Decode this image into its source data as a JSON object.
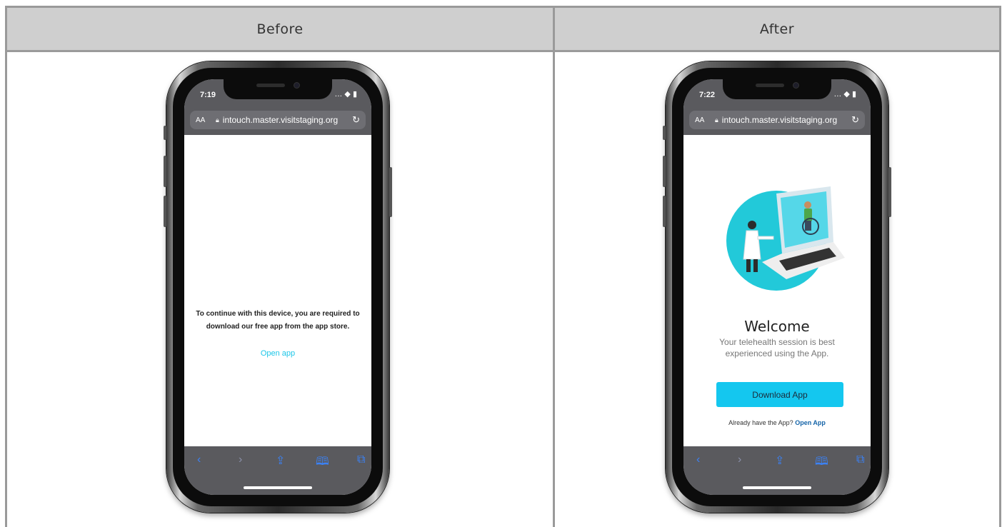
{
  "table": {
    "before_header": "Before",
    "after_header": "After"
  },
  "before_phone": {
    "time": "7:19",
    "status_icons": "… ◆ ▮",
    "text_size_label": "AA",
    "url": "intouch.master.visitstaging.org",
    "message": "To continue with this device, you are required to download our free app from the app store.",
    "open_app_link": "Open app"
  },
  "after_phone": {
    "time": "7:22",
    "status_icons": "… ◆ ▮",
    "text_size_label": "AA",
    "url": "intouch.master.visitstaging.org",
    "welcome_title": "Welcome",
    "subtitle": "Your telehealth session is best experienced using the App.",
    "download_button": "Download App",
    "already_text": "Already have the App?",
    "open_app_link": "Open App"
  },
  "toolbar_icons": [
    "back-icon",
    "forward-icon",
    "share-icon",
    "bookmarks-icon",
    "tabs-icon"
  ],
  "colors": {
    "accent_cyan": "#14c7ef",
    "link_blue": "#1564a8",
    "browser_chrome": "#5a5a5e",
    "header_gray": "#cfcfcf"
  }
}
